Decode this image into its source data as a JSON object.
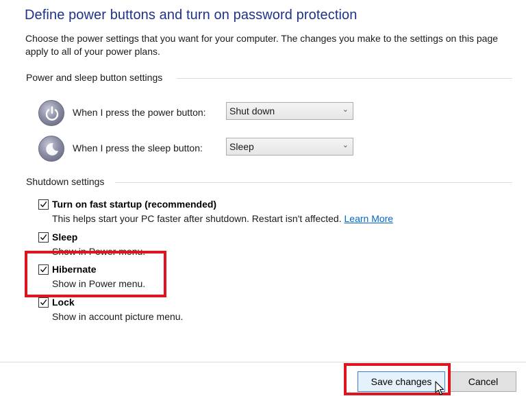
{
  "header": {
    "title": "Define power buttons and turn on password protection",
    "description": "Choose the power settings that you want for your computer. The changes you make to the settings on this page apply to all of your power plans."
  },
  "power_section": {
    "heading": "Power and sleep button settings",
    "rows": [
      {
        "label": "When I press the power button:",
        "value": "Shut down",
        "icon": "power-icon"
      },
      {
        "label": "When I press the sleep button:",
        "value": "Sleep",
        "icon": "sleep-icon"
      }
    ]
  },
  "shutdown_section": {
    "heading": "Shutdown settings",
    "items": [
      {
        "label": "Turn on fast startup (recommended)",
        "sub": "This helps start your PC faster after shutdown. Restart isn't affected.",
        "link": "Learn More",
        "checked": true
      },
      {
        "label": "Sleep",
        "sub": "Show in Power menu.",
        "checked": true
      },
      {
        "label": "Hibernate",
        "sub": "Show in Power menu.",
        "checked": true
      },
      {
        "label": "Lock",
        "sub": "Show in account picture menu.",
        "checked": true
      }
    ]
  },
  "footer": {
    "save_label": "Save changes",
    "cancel_label": "Cancel"
  },
  "colors": {
    "title": "#1e3287",
    "highlight": "#e0141e",
    "link": "#0066cc"
  }
}
